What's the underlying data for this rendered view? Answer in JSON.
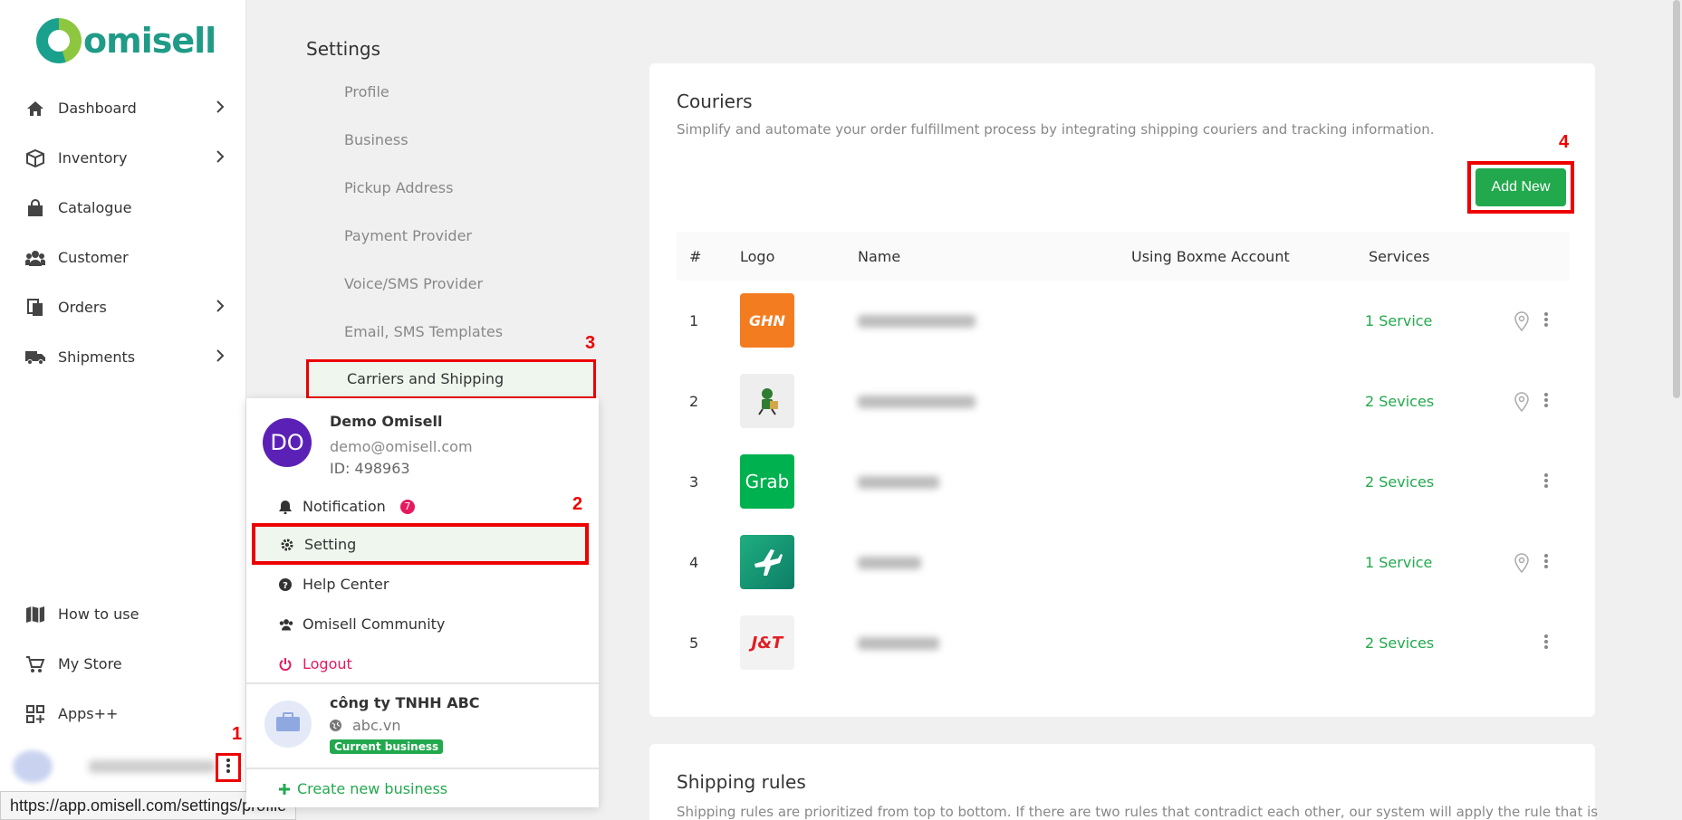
{
  "brand": {
    "name": "omisell",
    "colors": {
      "primary": "#22a94d",
      "accent": "#1f9b87",
      "alert": "#e00000"
    }
  },
  "sidebar": {
    "items": [
      {
        "label": "Dashboard",
        "icon": "home-icon",
        "expandable": true
      },
      {
        "label": "Inventory",
        "icon": "box-icon",
        "expandable": true
      },
      {
        "label": "Catalogue",
        "icon": "shopping-bag-icon",
        "expandable": false
      },
      {
        "label": "Customer",
        "icon": "users-icon",
        "expandable": false
      },
      {
        "label": "Orders",
        "icon": "orders-icon",
        "expandable": true
      },
      {
        "label": "Shipments",
        "icon": "truck-icon",
        "expandable": true
      }
    ],
    "bottom_items": [
      {
        "label": "How to use",
        "icon": "map-icon"
      },
      {
        "label": "My Store",
        "icon": "cart-icon"
      },
      {
        "label": "Apps++",
        "icon": "apps-icon"
      }
    ]
  },
  "annotations": {
    "one": "1",
    "two": "2",
    "three": "3",
    "four": "4"
  },
  "status_url": "https://app.omisell.com/settings/profile",
  "settings": {
    "title": "Settings",
    "menu": [
      "Profile",
      "Business",
      "Pickup Address",
      "Payment Provider",
      "Voice/SMS Provider",
      "Email, SMS Templates",
      "Carriers and Shipping"
    ]
  },
  "profile_menu": {
    "initials": "DO",
    "name": "Demo Omisell",
    "email": "demo@omisell.com",
    "id": "ID: 498963",
    "notification": "Notification",
    "notification_count": "7",
    "setting": "Setting",
    "help": "Help Center",
    "community": "Omisell Community",
    "logout": "Logout",
    "business": {
      "name": "công ty TNHH ABC",
      "domain": "abc.vn",
      "badge": "Current business"
    },
    "create_business": "Create new business"
  },
  "couriers": {
    "title": "Couriers",
    "subtitle": "Simplify and automate your order fulfillment process by integrating shipping couriers and tracking information.",
    "add_new": "Add New",
    "columns": [
      "#",
      "Logo",
      "Name",
      "Using Boxme Account",
      "Services"
    ],
    "rows": [
      {
        "index": "1",
        "logo_text": "GHN",
        "logo_bg": "#f47c20",
        "services": "1 Service",
        "has_location": true
      },
      {
        "index": "2",
        "logo_text": "",
        "logo_bg": "#eeeeee",
        "services": "2 Sevices",
        "has_location": true
      },
      {
        "index": "3",
        "logo_text": "Grab",
        "logo_bg": "#00b14f",
        "services": "2 Sevices",
        "has_location": false
      },
      {
        "index": "4",
        "logo_text": "",
        "logo_bg": "#16a07a",
        "services": "1 Service",
        "has_location": true
      },
      {
        "index": "5",
        "logo_text": "J&T",
        "logo_bg": "#f2f2f2",
        "services": "2 Sevices",
        "has_location": false
      }
    ]
  },
  "shipping_rules": {
    "title": "Shipping rules",
    "subtitle": "Shipping rules are prioritized from top to bottom. If there are two rules that contradict each other, our system will apply the rule that is"
  }
}
